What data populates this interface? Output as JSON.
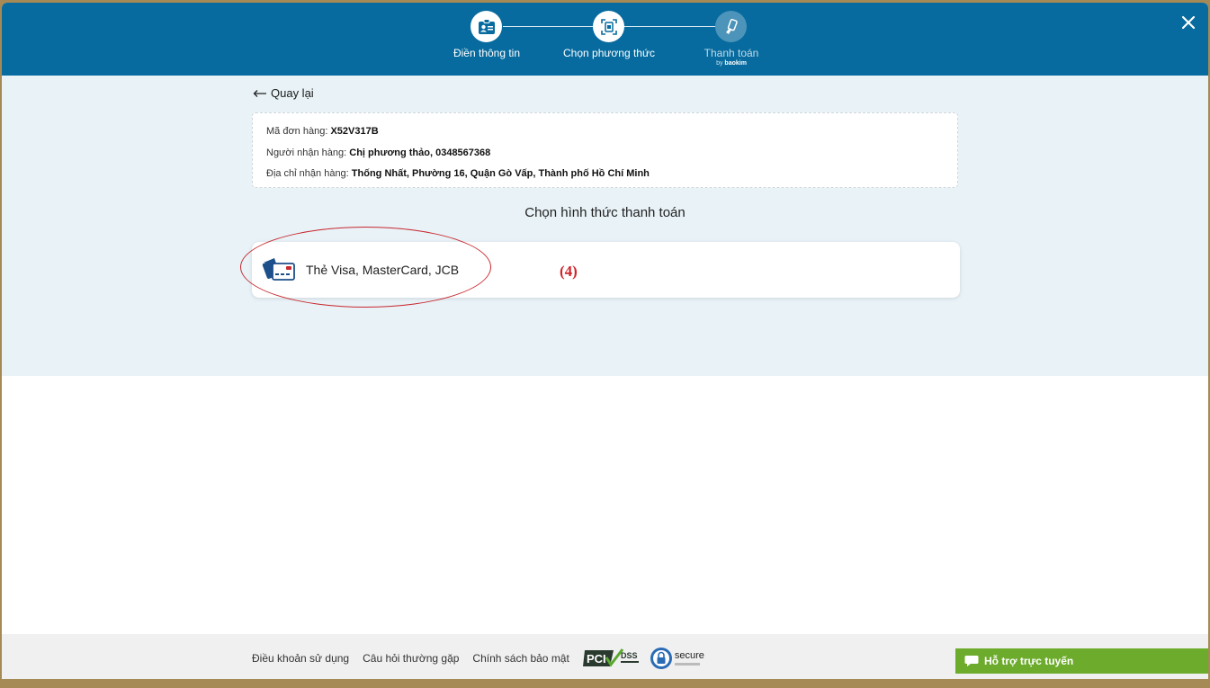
{
  "colors": {
    "header_bg": "#076b9f",
    "content_bg": "#e8f2f7",
    "annotation": "#d0242a",
    "chat_bg": "#6cab2c"
  },
  "header": {
    "steps": [
      {
        "label": "Điền thông tin",
        "icon": "id-card-icon",
        "state": "active"
      },
      {
        "label": "Chọn phương thức",
        "icon": "scan-icon",
        "state": "active"
      },
      {
        "label": "Thanh toán",
        "sub_prefix": "by",
        "sub_brand": "baokim",
        "icon": "tap-pay-icon",
        "state": "inactive"
      }
    ],
    "close_icon": "close-icon"
  },
  "back": {
    "label": "Quay lại",
    "icon": "arrow-left-icon"
  },
  "order": {
    "code_label": "Mã đơn hàng:",
    "code_value": "X52V317B",
    "receiver_label": "Người nhận hàng:",
    "receiver_value": "Chị phương thảo, 0348567368",
    "address_label": "Địa chỉ nhận hàng:",
    "address_value": "Thống Nhất, Phường 16, Quận Gò Vấp, Thành phố Hồ Chí Minh"
  },
  "payment": {
    "title": "Chọn hình thức thanh toán",
    "methods": [
      {
        "label": "Thẻ Visa, MasterCard, JCB",
        "icon": "credit-card-icon"
      }
    ]
  },
  "annotation": {
    "label": "(4)"
  },
  "footer": {
    "links": [
      "Điều khoản sử dụng",
      "Câu hỏi thường gặp",
      "Chính sách bảo mật"
    ],
    "pci_text": "PCI",
    "dss_text": "DSS",
    "secure_text": "secure"
  },
  "chat": {
    "label": "Hỗ trợ trực tuyến",
    "icon": "chat-bubble-icon"
  }
}
